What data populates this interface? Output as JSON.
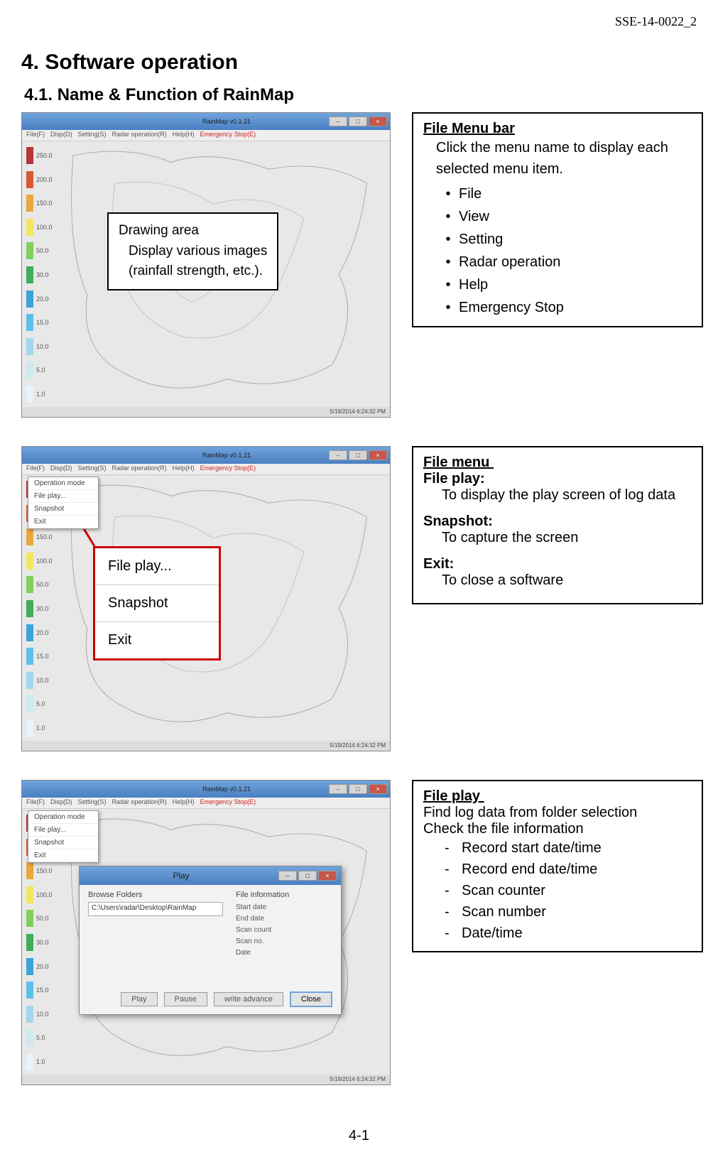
{
  "header_code": "SSE-14-0022_2",
  "h1": "4.  Software operation",
  "h2": "4.1. Name & Function of RainMap",
  "app_title": "RainMap v0.1.21",
  "menubar_items": [
    "File(F)",
    "Disp(D)",
    "Setting(S)",
    "Radar operation(R)",
    "Help(H)",
    "Emergency Stop(E)"
  ],
  "scale_ticks": [
    "250.0",
    "200.0",
    "150.0",
    "100.0",
    "50.0",
    "30.0",
    "20.0",
    "15.0",
    "10.0",
    "5.0",
    "1.0"
  ],
  "scale_colors": [
    "#b73438",
    "#d85a33",
    "#e9a83b",
    "#f3e65e",
    "#7fcf5b",
    "#3fae57",
    "#3aa4d8",
    "#5bc0e8",
    "#a2d7ee",
    "#cfe8f3",
    "#e8f3fa"
  ],
  "status_time": "5/19/2014 6:24:32 PM",
  "callout1": {
    "title": "Drawing area",
    "line1": "Display various images",
    "line2": "(rainfall strength, etc.)."
  },
  "box1": {
    "title": "File Menu bar",
    "desc": "Click the menu name to display each selected menu item.",
    "items": [
      "File",
      "View",
      "Setting",
      "Radar operation",
      "Help",
      "Emergency Stop"
    ]
  },
  "dropdown_items": [
    "Operation mode",
    "File play...",
    "Snapshot",
    "Exit"
  ],
  "popup_items": [
    "File play...",
    "Snapshot",
    "Exit"
  ],
  "box2": {
    "title": "File menu",
    "sub1": "File play:",
    "sub1desc": "To display the play screen of log data",
    "sub2": "Snapshot:",
    "sub2desc": "To capture the screen",
    "sub3": "Exit:",
    "sub3desc": "To close a software"
  },
  "play_dialog": {
    "title": "Play",
    "browse_label": "Browse Folders",
    "path": "C:\\Users\\radar\\Desktop\\RainMap",
    "info_label": "File information",
    "info_items": [
      "Start date",
      "End date",
      "Scan count",
      "Scan no.",
      "Date"
    ],
    "btns": {
      "play": "Play",
      "pause": "Pause",
      "adv": "write advance",
      "close": "Close"
    }
  },
  "box3": {
    "title": "File play",
    "line1": "Find log data from folder selection",
    "line2": "Check the file information",
    "items": [
      "Record start date/time",
      "Record end date/time",
      "Scan counter",
      "Scan number",
      "Date/time"
    ]
  },
  "page_num": "4-1"
}
